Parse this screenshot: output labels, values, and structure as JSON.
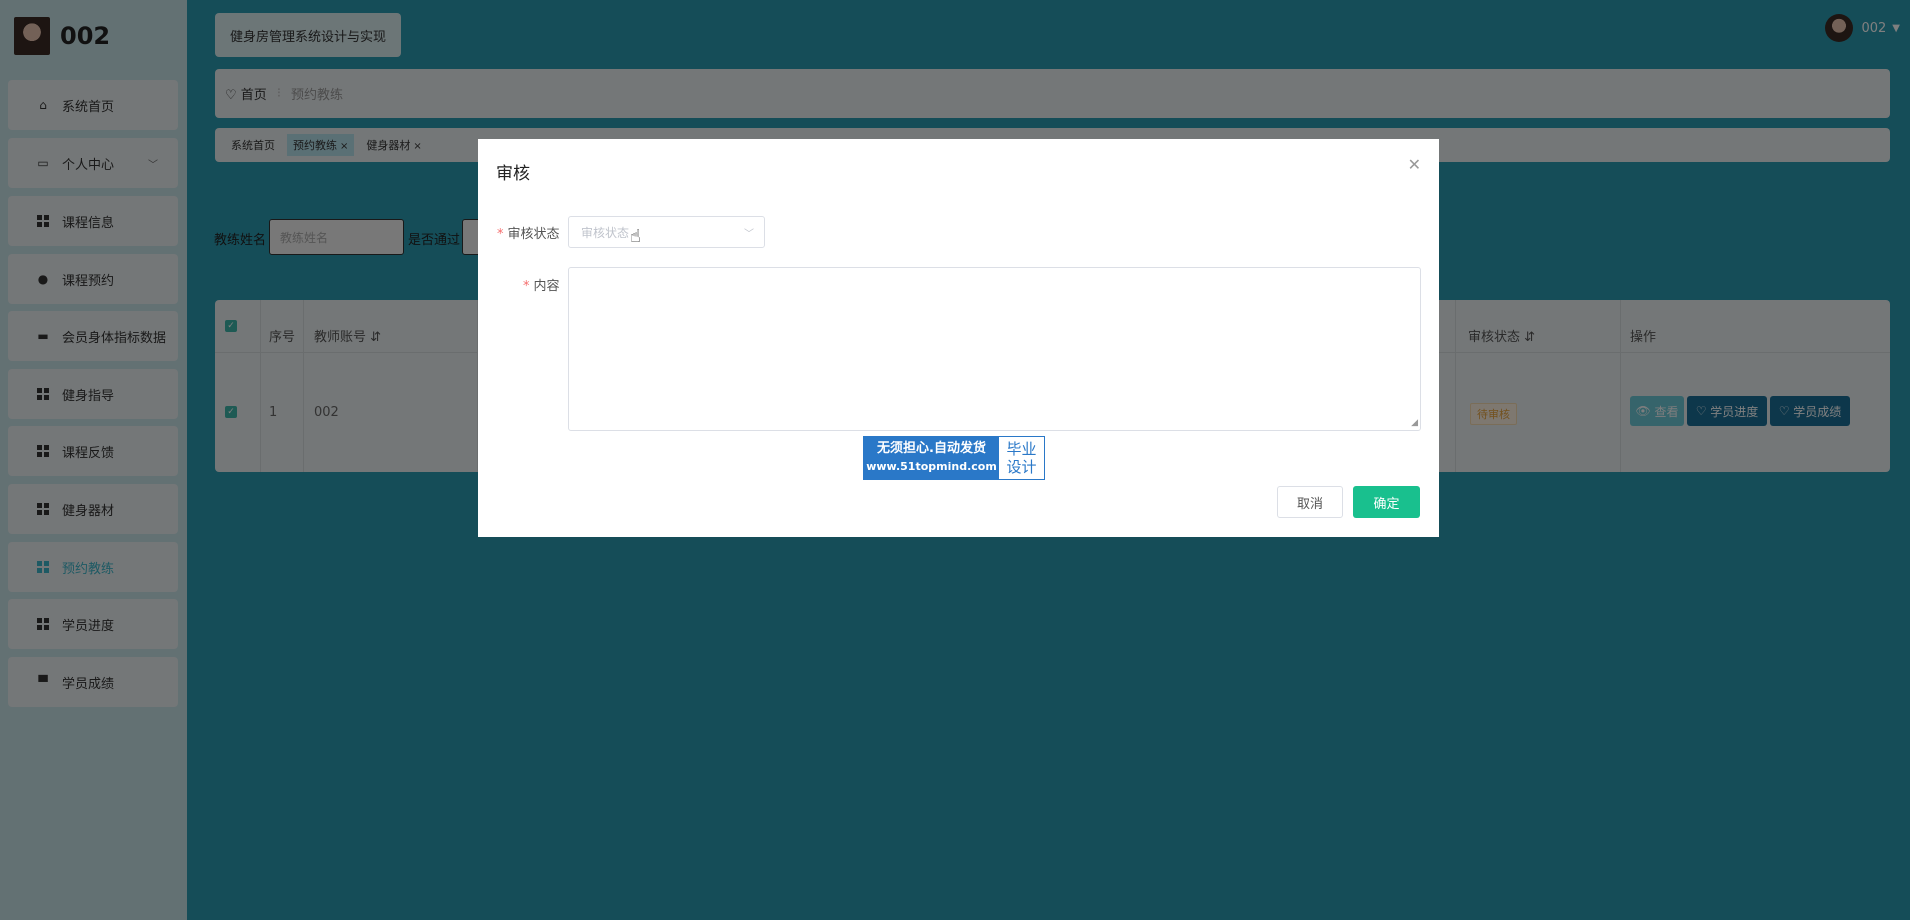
{
  "sidebar": {
    "brand_name": "002",
    "items": [
      {
        "label": "系统首页",
        "icon": "home-icon"
      },
      {
        "label": "个人中心",
        "icon": "id-card-icon"
      },
      {
        "label": "课程信息",
        "icon": "grid-icon"
      },
      {
        "label": "课程预约",
        "icon": "user-icon"
      },
      {
        "label": "会员身体指标数据",
        "icon": "monitor-icon"
      },
      {
        "label": "健身指导",
        "icon": "grid-icon"
      },
      {
        "label": "课程反馈",
        "icon": "grid-icon"
      },
      {
        "label": "健身器材",
        "icon": "grid-icon"
      },
      {
        "label": "预约教练",
        "icon": "grid-icon"
      },
      {
        "label": "学员进度",
        "icon": "grid-icon"
      },
      {
        "label": "学员成绩",
        "icon": "printer-icon"
      }
    ]
  },
  "header": {
    "system_title": "健身房管理系统设计与实现",
    "user_name": "002"
  },
  "breadcrumb": {
    "home": "首页",
    "current": "预约教练"
  },
  "tabs": [
    {
      "label": "系统首页"
    },
    {
      "label": "预约教练",
      "closable": "×"
    },
    {
      "label": "健身器材",
      "closable": "×"
    }
  ],
  "search": {
    "coach_label": "教练姓名",
    "coach_placeholder": "教练姓名",
    "passed_label": "是否通过"
  },
  "table": {
    "headers": {
      "index": "序号",
      "account": "教师账号",
      "status": "审核状态",
      "ops": "操作"
    },
    "rows": [
      {
        "index": "1",
        "account": "002",
        "status": "待审核"
      }
    ],
    "buttons": {
      "view": "查看",
      "progress": "学员进度",
      "score": "学员成绩"
    }
  },
  "dialog": {
    "title": "审核",
    "status_label": "审核状态",
    "status_placeholder": "审核状态",
    "content_label": "内容",
    "required_mark": "*",
    "cancel": "取消",
    "confirm": "确定",
    "ad_line1": "无须担心.自动发货",
    "ad_line2": "www.51topmind.com",
    "ad_right1": "毕业",
    "ad_right2": "设计"
  },
  "colors": {
    "main_bg": "#2b9ab0",
    "sidebar_bg": "#c7e3e7",
    "accent": "#3cb4c8",
    "confirm": "#19c08e",
    "warning": "#e6a23c"
  }
}
